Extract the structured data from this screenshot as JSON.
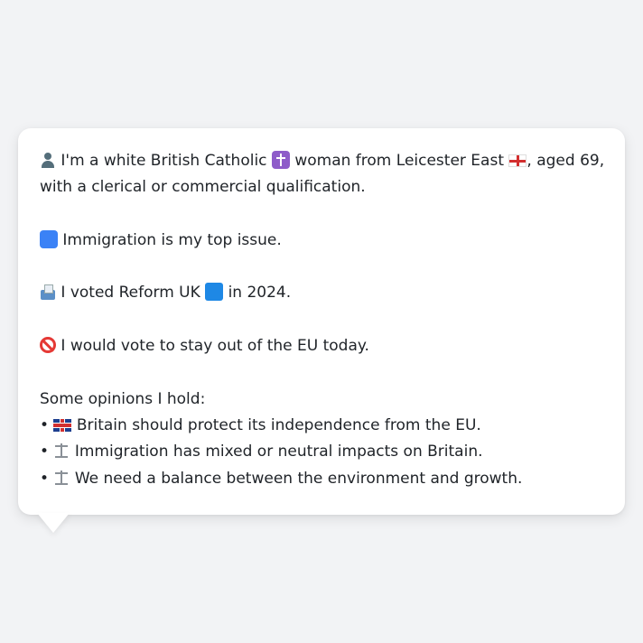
{
  "profile": {
    "intro": {
      "icon": "person-silhouette-icon",
      "text_a": "I'm a white British Catholic",
      "icon_cross": "latin-cross-icon",
      "text_b": "woman from Leicester East",
      "icon_flag": "england-flag-icon",
      "text_c": ", aged 69,",
      "text_d": "with a clerical or commercial qualification."
    },
    "issue": {
      "icon": "passport-control-icon",
      "text": "Immigration is my top issue."
    },
    "vote": {
      "icon": "ballot-box-icon",
      "text_a": "I voted Reform UK",
      "icon_party": "blue-square-icon",
      "text_b": "in 2024."
    },
    "eu": {
      "icon": "no-entry-sign-icon",
      "text": "I would vote to stay out of the EU today."
    },
    "opinions": {
      "heading": "Some opinions I hold:",
      "bullet": "•",
      "items": [
        {
          "icon": "uk-flag-icon",
          "text": "Britain should protect its independence from the EU."
        },
        {
          "icon": "balance-scale-icon",
          "text": "Immigration has mixed or neutral impacts on Britain."
        },
        {
          "icon": "balance-scale-icon",
          "text": "We need a balance between the environment and growth."
        }
      ]
    }
  }
}
